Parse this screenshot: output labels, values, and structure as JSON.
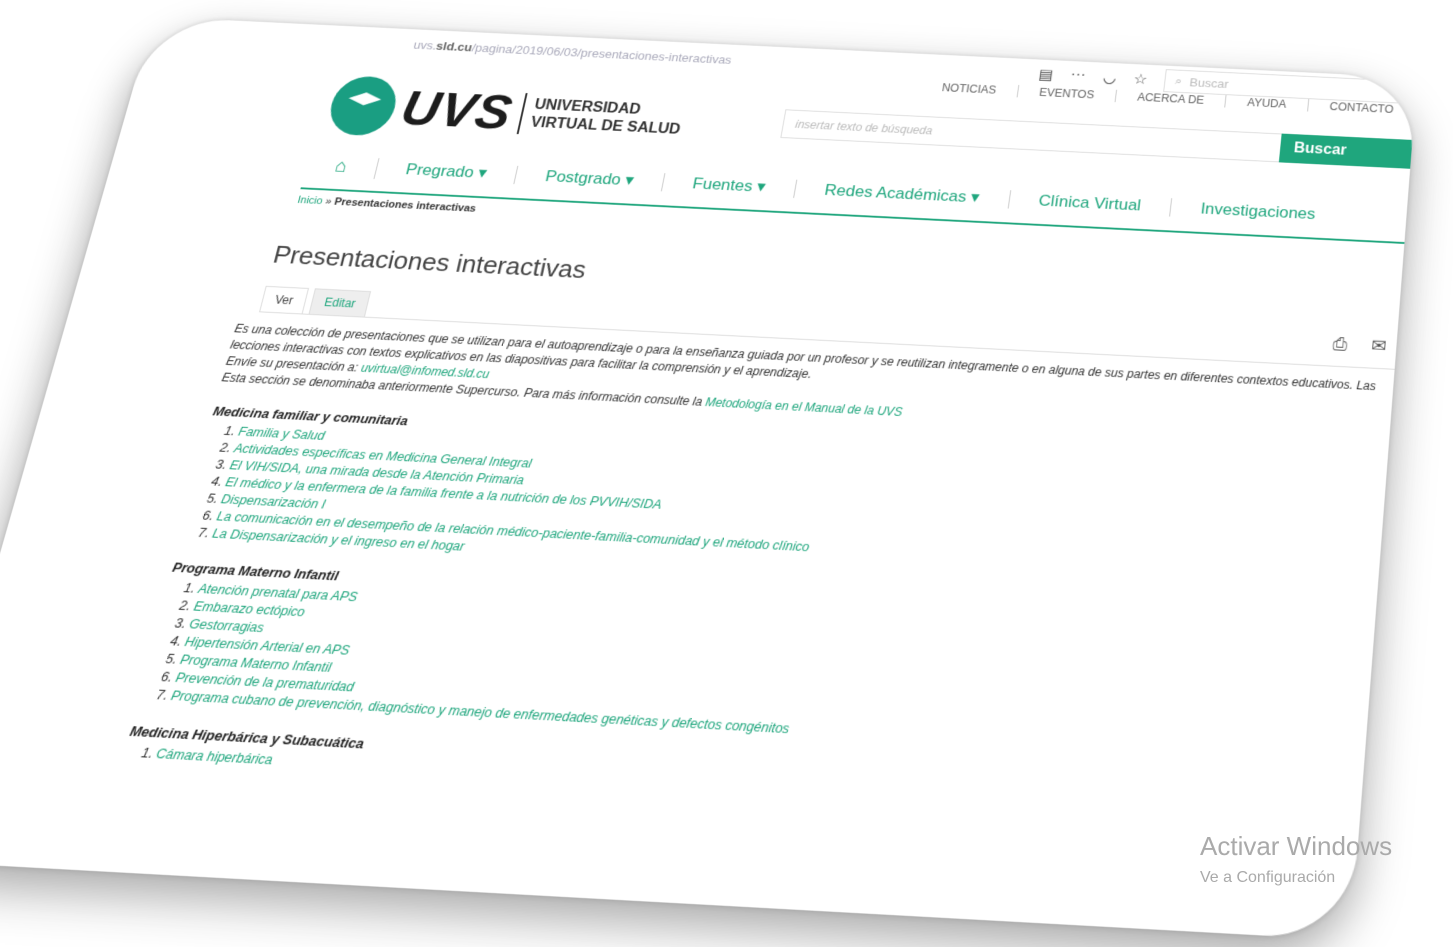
{
  "browser": {
    "url_prefix": "uvs.",
    "url_domain": "sld.cu",
    "url_path": "/pagina/2019/06/03/presentaciones-interactivas",
    "search_placeholder": "Buscar",
    "icons": [
      "reader-icon",
      "more-icon",
      "pocket-icon",
      "star-icon"
    ]
  },
  "topnav": [
    "NOTICIAS",
    "EVENTOS",
    "ACERCA DE",
    "AYUDA",
    "CONTACTO"
  ],
  "logo": {
    "short": "UVS",
    "line1": "UNIVERSIDAD",
    "line2": "VIRTUAL DE SALUD"
  },
  "search": {
    "placeholder": "insertar texto de búsqueda",
    "button": "Buscar",
    "button_icon": "›"
  },
  "mainnav": [
    "Pregrado",
    "Postgrado",
    "Fuentes",
    "Redes Académicas",
    "Clínica Virtual",
    "Investigaciones"
  ],
  "breadcrumb": {
    "home": "Inicio",
    "sep": " » ",
    "current": "Presentaciones interactivas"
  },
  "page_title": "Presentaciones interactivas",
  "tabs": {
    "view": "Ver",
    "edit": "Editar"
  },
  "intro": {
    "p1": "Es una colección de presentaciones que se utilizan para el autoaprendizaje o para la enseñanza guiada por un profesor y se reutilizan integramente o en alguna de sus partes en diferentes contextos educativos. Las lecciones interactivas con textos explicativos en las diapositivas para facilitar la comprensión y el aprendizaje.",
    "p2_label": "Envíe su presentación a: ",
    "p2_email": "uvirtual@infomed.sld.cu",
    "p3": "Esta sección se denominaba anteriormente Supercurso. Para más información consulte la ",
    "p3_link": "Metodología en el Manual de la UVS"
  },
  "sections": [
    {
      "title": "Medicina familiar y comunitaria",
      "items": [
        "Familia y Salud",
        "Actividades específicas en Medicina General Integral",
        "El VIH/SIDA, una mirada desde la Atención Primaria",
        "El médico y la enfermera de la familia frente a la nutrición de los PVVIH/SIDA",
        "Dispensarización I",
        "La comunicación en el desempeño de la relación médico-paciente-familia-comunidad y el método clínico",
        "La Dispensarización y el ingreso en el hogar"
      ]
    },
    {
      "title": "Programa Materno Infantil",
      "items": [
        "Atención prenatal para APS",
        "Embarazo ectópico",
        "Gestorragias",
        "Hipertensión Arterial en APS",
        "Programa Materno Infantil",
        "Prevención de la prematuridad",
        "Programa cubano de prevención, diagnóstico y manejo de enfermedades genéticas y defectos congénitos"
      ]
    },
    {
      "title": "Medicina Hiperbárica y Subacuática",
      "items": [
        "Cámara hiperbárica"
      ]
    }
  ],
  "watermark": {
    "line1": "Activar Windows",
    "line2": "Ve a Configuración"
  },
  "colors": {
    "accent": "#1fa67d",
    "text": "#333333"
  }
}
